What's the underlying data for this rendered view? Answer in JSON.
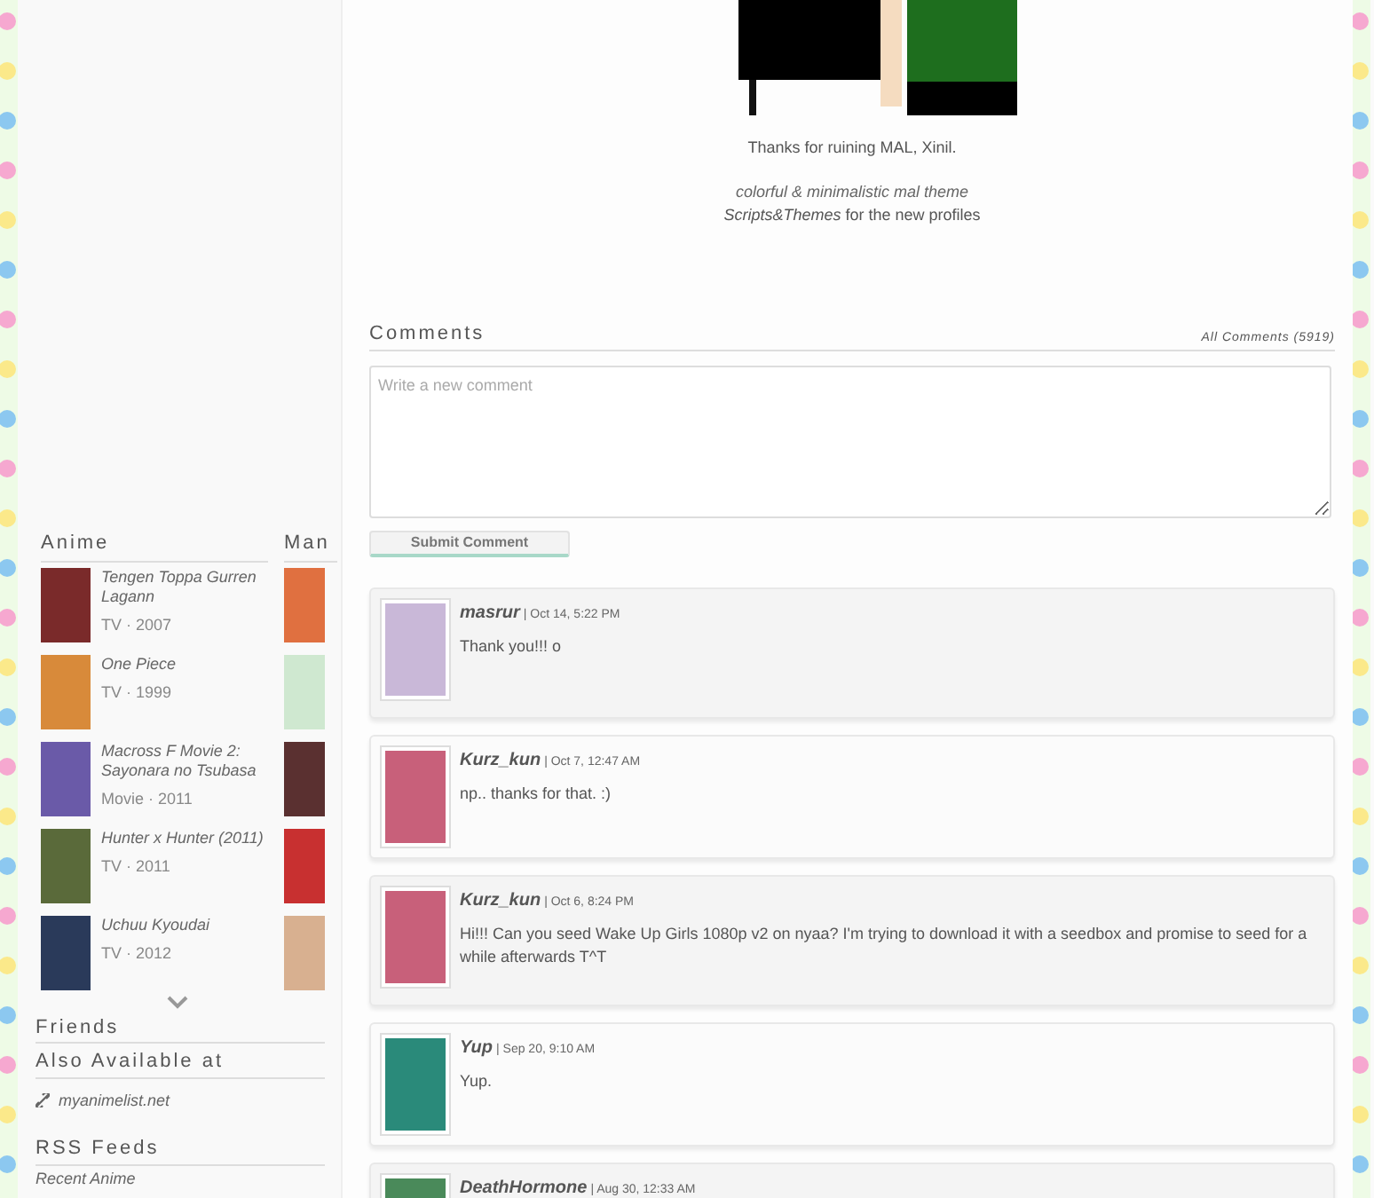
{
  "sidebar": {
    "anime_heading": "Anime",
    "manga_heading": "Man",
    "anime": [
      {
        "title": "Tengen Toppa Gurren Lagann",
        "meta": "TV · 2007"
      },
      {
        "title": "One Piece",
        "meta": "TV · 1999"
      },
      {
        "title": "Macross F Movie 2: Sayonara no Tsubasa",
        "meta": "Movie · 2011"
      },
      {
        "title": "Hunter x Hunter (2011)",
        "meta": "TV · 2011"
      },
      {
        "title": "Uchuu Kyoudai",
        "meta": "TV · 2012"
      }
    ],
    "friends_heading": "Friends",
    "also_heading": "Also Available at",
    "link": "myanimelist.net",
    "rss_heading": "RSS Feeds",
    "rss_items": [
      "Recent Anime"
    ]
  },
  "profile": {
    "thanks": "Thanks for ruining MAL, Xinil.",
    "theme_line": "colorful & minimalistic mal theme",
    "scripts_line": "*Scripts&Themes* for the new profiles"
  },
  "comments": {
    "heading": "Comments",
    "all_link": "All Comments (5919)",
    "placeholder": "Write a new comment",
    "submit": "Submit Comment",
    "items": [
      {
        "user": "masrur",
        "date": "| Oct 14, 5:22 PM",
        "text": "Thank you!!! o"
      },
      {
        "user": "Kurz_kun",
        "date": "| Oct 7, 12:47 AM",
        "text": "np.. thanks for that. :)"
      },
      {
        "user": "Kurz_kun",
        "date": "| Oct 6, 8:24 PM",
        "text": "Hi!!! Can you seed Wake Up Girls 1080p v2 on nyaa? I'm trying to download it with a seedbox and promise to seed for a while afterwards T^T"
      },
      {
        "user": "Yup",
        "date": "| Sep 20, 9:10 AM",
        "text": "Yup."
      },
      {
        "user": "DeathHormone",
        "date": "| Aug 30, 12:33 AM"
      }
    ]
  }
}
